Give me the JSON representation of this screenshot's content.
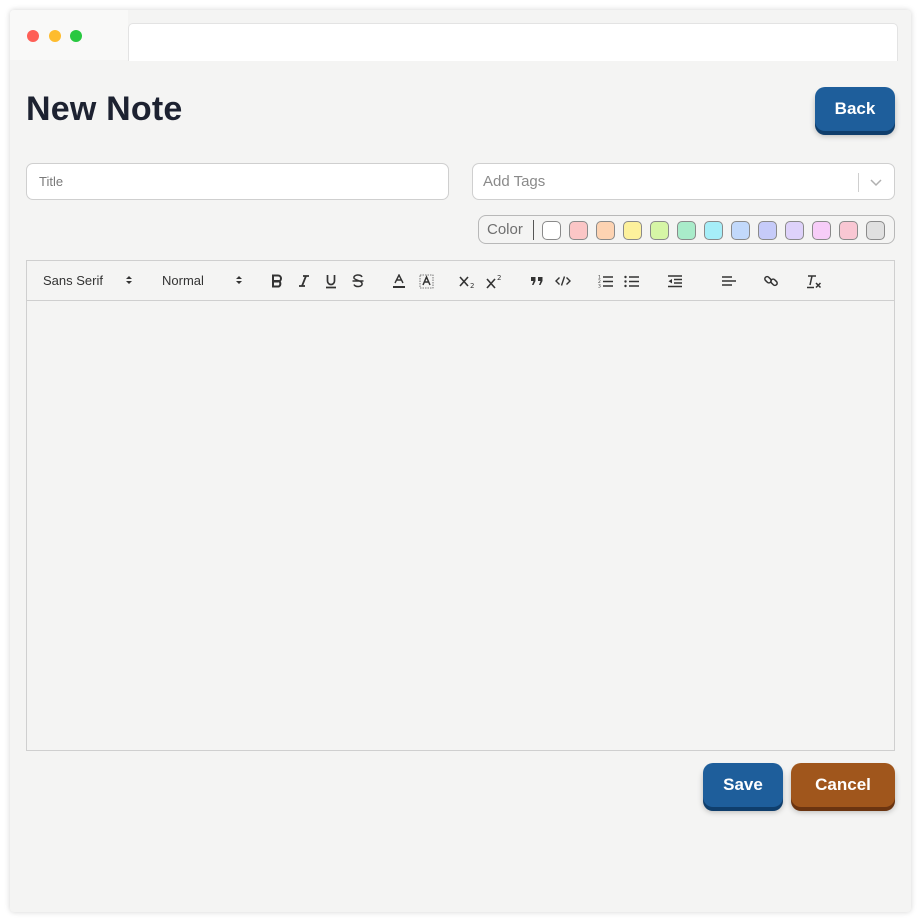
{
  "page": {
    "title": "New Note"
  },
  "buttons": {
    "back": "Back",
    "save": "Save",
    "cancel": "Cancel"
  },
  "title_input": {
    "placeholder": "Title",
    "value": ""
  },
  "tags_input": {
    "placeholder": "Add Tags"
  },
  "color_picker": {
    "label": "Color",
    "swatches": [
      "#ffffff",
      "#fbc6c6",
      "#fdd3b2",
      "#fdf19c",
      "#d6f6a6",
      "#a9ecca",
      "#a6eef8",
      "#c2d9fb",
      "#c6cbf9",
      "#ded2fa",
      "#f7cdf8",
      "#f9c7d3",
      "#e0e0e0"
    ]
  },
  "toolbar": {
    "font": "Sans Serif",
    "size": "Normal",
    "icons": [
      "bold-icon",
      "italic-icon",
      "underline-icon",
      "strike-icon",
      "text-color-icon",
      "background-color-icon",
      "subscript-icon",
      "superscript-icon",
      "blockquote-icon",
      "code-block-icon",
      "ordered-list-icon",
      "bullet-list-icon",
      "outdent-icon",
      "align-icon",
      "link-icon",
      "clean-format-icon"
    ]
  },
  "colors": {
    "primary": "#1e5e9b",
    "cancel": "#a0561c",
    "title_text": "#1d2231"
  }
}
